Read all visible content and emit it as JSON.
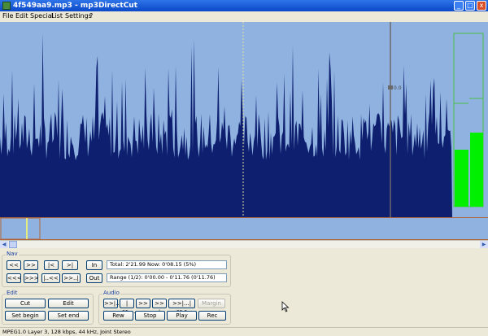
{
  "window": {
    "title": "4f549aa9.mp3 - mp3DirectCut",
    "minimize_glyph": "_",
    "maximize_glyph": "□",
    "close_glyph": "x"
  },
  "menu": [
    "File",
    "Edit",
    "Special",
    "List",
    "Settings",
    "?"
  ],
  "waveform": {
    "marker_label": "0.0",
    "colors": {
      "background": "#8fb2e0",
      "wave": "#0d1f6e",
      "meter": "#00f000",
      "meter_outline": "#4bc04b",
      "cursor": "#6a6a6a",
      "dashed_marker": "#e8e0a0"
    }
  },
  "nav": {
    "title": "Nav",
    "buttons": [
      "<<",
      ">>",
      "|<",
      ">|",
      "In",
      "<<<",
      ">>>",
      "|..<<",
      ">>..|",
      "Out"
    ],
    "total_line": "Total: 2'21.99   Now: 0'08.15  (5%)",
    "range_line": "Range (1/2): 0'00.00 - 0'11.76 (0'11.76)"
  },
  "edit": {
    "title": "Edit",
    "buttons": [
      "Cut",
      "Edit",
      "Set begin",
      "Set end"
    ]
  },
  "audio": {
    "title": "Audio",
    "top_buttons": [
      ">>|...",
      "|<>...",
      ">> -",
      ">> +",
      ">>|...|<>>",
      "Margin"
    ],
    "bottom_buttons": [
      "Rew",
      "Stop",
      "Play",
      "Rec"
    ]
  },
  "status": "MPEG1.0 Layer 3, 128 kbps, 44 kHz, Joint Stereo"
}
